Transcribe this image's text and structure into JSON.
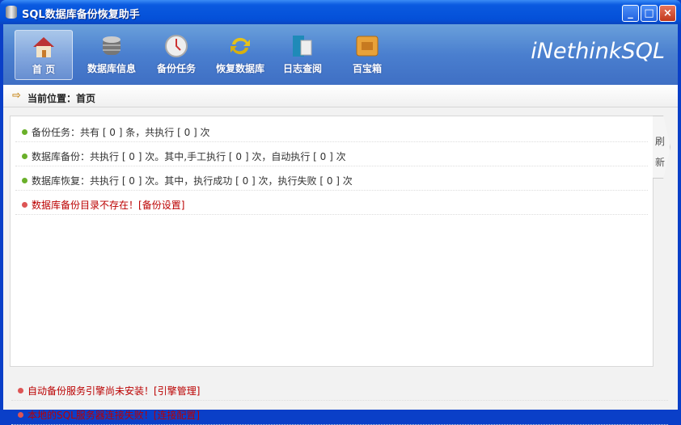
{
  "window": {
    "title": "SQL数据库备份恢复助手",
    "controls": [
      "_",
      "□",
      "×"
    ]
  },
  "toolbar": {
    "items": [
      {
        "label": "首 页",
        "icon": "home-icon",
        "active": true
      },
      {
        "label": "数据库信息",
        "icon": "database-icon"
      },
      {
        "label": "备份任务",
        "icon": "clock-icon"
      },
      {
        "label": "恢复数据库",
        "icon": "refresh-arrows-icon"
      },
      {
        "label": "日志查阅",
        "icon": "book-icon"
      },
      {
        "label": "百宝箱",
        "icon": "box-icon"
      }
    ],
    "brand": "iNethinkSQL"
  },
  "breadcrumb": "当前位置：首页",
  "status": [
    {
      "text": "备份任务：共有 [ 0 ] 条，共执行 [ 0 ] 次",
      "type": "ok"
    },
    {
      "text": "数据库备份：共执行 [ 0 ] 次。其中,手工执行 [ 0 ] 次，自动执行 [ 0 ] 次",
      "type": "ok"
    },
    {
      "text": "数据库恢复：共执行 [ 0 ] 次。其中，执行成功 [ 0 ] 次，执行失败 [ 0 ] 次",
      "type": "ok"
    },
    {
      "text": "数据库备份目录不存在！",
      "link": "[备份设置]",
      "type": "error"
    }
  ],
  "refresh": {
    "line1": "刷",
    "line2": "新"
  },
  "alerts": [
    {
      "text": "自动备份服务引擎尚未安装！",
      "link": "[引擎管理]"
    },
    {
      "text": "本地的SQL服务器连接失败！",
      "link": "[连接配置]"
    }
  ]
}
